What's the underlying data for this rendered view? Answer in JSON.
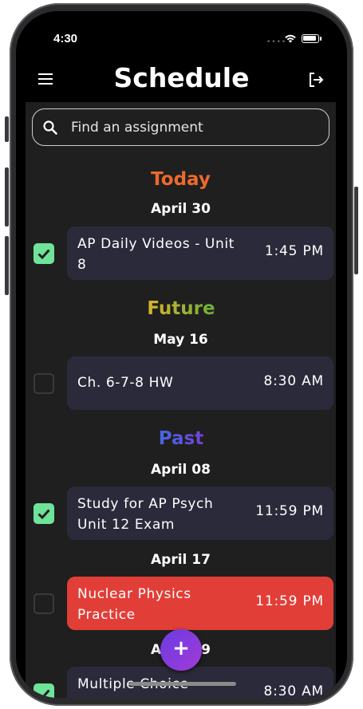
{
  "status_bar": {
    "time": "4:30",
    "signal": "••••"
  },
  "app_bar": {
    "title": "Schedule",
    "menu_icon": "hamburger-menu-icon",
    "logout_icon": "logout-icon"
  },
  "search": {
    "placeholder": "Find an assignment",
    "icon": "search-icon"
  },
  "sections": {
    "today": {
      "label": "Today",
      "color": "#ec6a2c"
    },
    "future": {
      "label": "Future",
      "color_from": "#e3b52a",
      "color_to": "#5fae3a"
    },
    "past": {
      "label": "Past",
      "color_from": "#3b6fe0",
      "color_to": "#7a3bd8"
    }
  },
  "groups": {
    "g1": {
      "date": "April 30",
      "item": {
        "title": "AP Daily Videos - Unit 8",
        "time": "1:45 PM",
        "checked": true,
        "overdue": false
      }
    },
    "g2": {
      "date": "May 16",
      "item": {
        "title": "Ch. 6-7-8 HW",
        "time": "8:30 AM",
        "checked": false,
        "overdue": false
      }
    },
    "g3": {
      "date": "April 08",
      "item": {
        "title": "Study for AP Psych Unit 12 Exam",
        "time": "11:59 PM",
        "checked": true,
        "overdue": false
      }
    },
    "g4": {
      "date": "April 17",
      "item": {
        "title": "Nuclear Physics Practice",
        "time": "11:59 PM",
        "checked": false,
        "overdue": true
      }
    },
    "g5": {
      "date": "April 19",
      "item": {
        "title": "Multiple Choice",
        "time": "8:30 AM",
        "checked": true,
        "overdue": false
      }
    }
  },
  "fab": {
    "label": "+",
    "icon": "plus-icon"
  },
  "colors": {
    "card_bg": "#2b2a3b",
    "overdue_bg": "#e23e38",
    "checked": "#6fe39a",
    "background": "#1f1f1f"
  }
}
